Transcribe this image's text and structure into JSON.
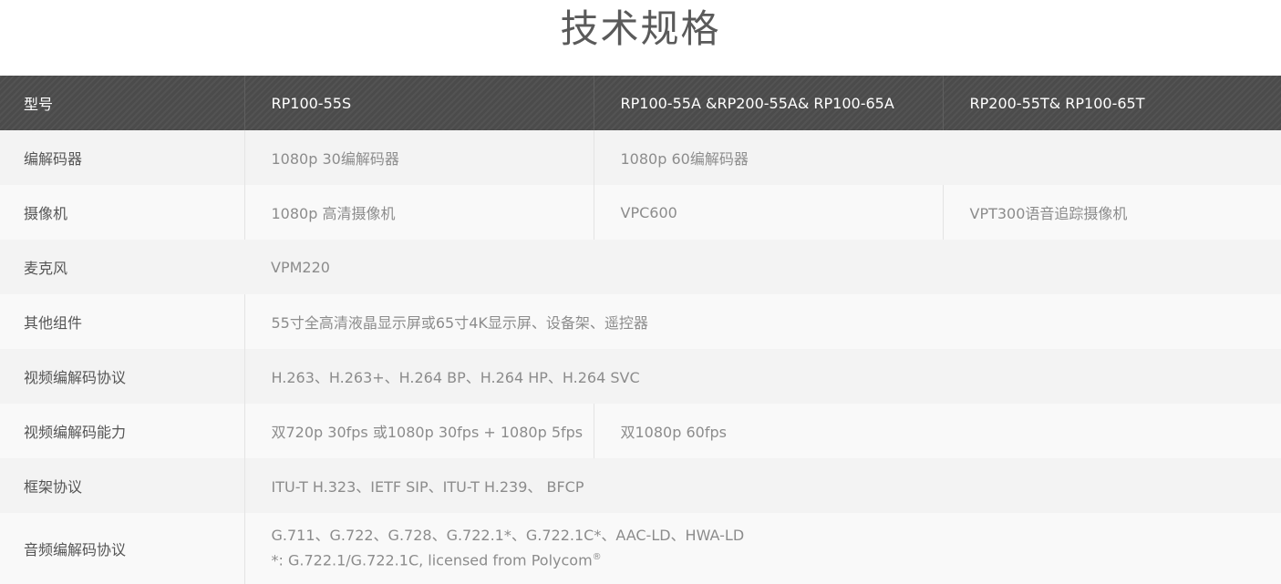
{
  "page": {
    "title": "技术规格"
  },
  "table": {
    "header": {
      "label": "型号",
      "col1": "RP100-55S",
      "col2": "RP100-55A &RP200-55A& RP100-65A",
      "col3": "RP200-55T& RP100-65T"
    },
    "rows": {
      "codec": {
        "label": "编解码器",
        "col1": "1080p 30编解码器",
        "col2": "1080p 60编解码器"
      },
      "camera": {
        "label": "摄像机",
        "col1": "1080p 高清摄像机",
        "col2": "VPC600",
        "col3": "VPT300语音追踪摄像机"
      },
      "microphone": {
        "label": "麦克风",
        "value": "VPM220"
      },
      "other": {
        "label": "其他组件",
        "value": "55寸全高清液晶显示屏或65寸4K显示屏、设备架、遥控器"
      },
      "video_protocol": {
        "label": "视频编解码协议",
        "value": "H.263、H.263+、H.264 BP、H.264 HP、H.264 SVC"
      },
      "video_capability": {
        "label": "视频编解码能力",
        "col1": "双720p 30fps 或1080p 30fps + 1080p 5fps",
        "col2": "双1080p 60fps"
      },
      "frame_protocol": {
        "label": "框架协议",
        "value": "ITU-T H.323、IETF SIP、ITU-T H.239、 BFCP"
      },
      "audio_protocol": {
        "label": "音频编解码协议",
        "line1": "G.711、G.722、G.728、G.722.1*、G.722.1C*、AAC-LD、HWA-LD",
        "line2": "*: G.722.1/G.722.1C, licensed from Polycom",
        "line2_mark": "®"
      }
    }
  }
}
